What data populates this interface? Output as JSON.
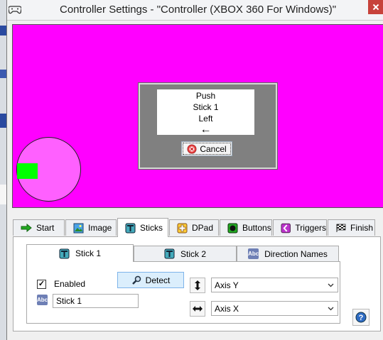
{
  "window": {
    "title": "Controller Settings - \"Controller (XBOX 360 For Windows)\""
  },
  "prompt": {
    "line1": "Push",
    "line2": "Stick 1",
    "line3": "Left",
    "arrow": "←"
  },
  "cancel_label": "Cancel",
  "tabs": [
    {
      "label": "Start",
      "icon": "arrow-right-icon",
      "active": false
    },
    {
      "label": "Image",
      "icon": "image-icon",
      "active": false
    },
    {
      "label": "Sticks",
      "icon": "stick-icon",
      "active": true
    },
    {
      "label": "DPad",
      "icon": "dpad-icon",
      "active": false
    },
    {
      "label": "Buttons",
      "icon": "button-icon",
      "active": false
    },
    {
      "label": "Triggers",
      "icon": "trigger-icon",
      "active": false
    },
    {
      "label": "Finish",
      "icon": "checkered-flag-icon",
      "active": false
    }
  ],
  "subtabs": [
    {
      "label": "Stick 1",
      "active": true
    },
    {
      "label": "Stick 2",
      "active": false
    },
    {
      "label": "Direction Names",
      "active": false
    }
  ],
  "stick": {
    "enabled_label": "Enabled",
    "enabled": true,
    "detect_label": "Detect",
    "name_value": "Stick 1",
    "vertical_axis": "Axis Y",
    "horizontal_axis": "Axis X"
  },
  "colors": {
    "stage": "#ff00ff",
    "circle": "#ff60ff",
    "stick_position": "#00ff00"
  }
}
